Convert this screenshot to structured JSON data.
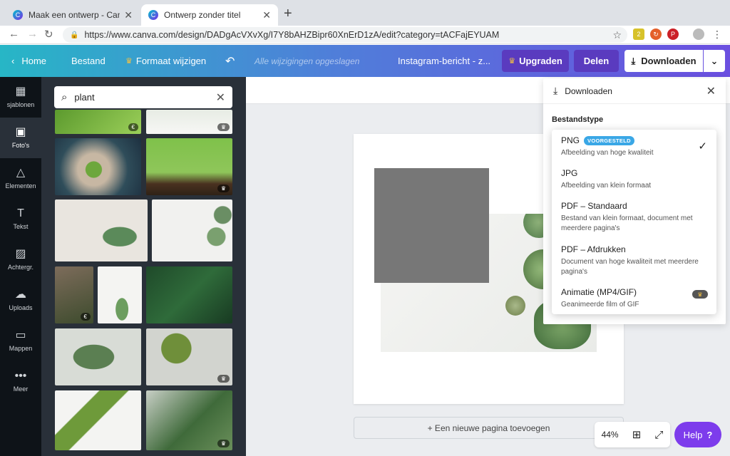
{
  "browser": {
    "tabs": [
      {
        "title": "Maak een ontwerp - Canva",
        "favicon": "C"
      },
      {
        "title": "Ontwerp zonder titel",
        "favicon": "C"
      }
    ],
    "url": "https://www.canva.com/design/DADgAcVXvXg/I7Y8bAHZBipr60XnErD1zA/edit?category=tACFajEYUAM",
    "extension_badge": "2"
  },
  "topbar": {
    "home": "Home",
    "file": "Bestand",
    "resize": "Formaat wijzigen",
    "saved_status": "Alle wijzigingen opgeslagen",
    "design_title": "Instagram-bericht - z...",
    "upgrade": "Upgraden",
    "share": "Delen",
    "download": "Downloaden"
  },
  "rail": [
    {
      "label": "sjablonen",
      "icon": "layout-icon"
    },
    {
      "label": "Foto's",
      "icon": "photo-icon"
    },
    {
      "label": "Elementen",
      "icon": "shapes-icon"
    },
    {
      "label": "Tekst",
      "icon": "text-icon"
    },
    {
      "label": "Achtergr.",
      "icon": "background-icon"
    },
    {
      "label": "Uploads",
      "icon": "upload-icon"
    },
    {
      "label": "Mappen",
      "icon": "folder-icon"
    },
    {
      "label": "Meer",
      "icon": "more-icon"
    }
  ],
  "search": {
    "value": "plant"
  },
  "badges": {
    "paid": "€",
    "premium": "♛"
  },
  "canvas": {
    "add_page": "+ Een nieuwe pagina toevoegen",
    "zoom": "44%",
    "help": "Help",
    "help_mark": "?"
  },
  "download_panel": {
    "title": "Downloaden",
    "filetype_label": "Bestandstype",
    "options": [
      {
        "name": "PNG",
        "badge": "VOORGESTELD",
        "desc": "Afbeelding van hoge kwaliteit"
      },
      {
        "name": "JPG",
        "desc": "Afbeelding van klein formaat"
      },
      {
        "name": "PDF – Standaard",
        "desc": "Bestand van klein formaat, document met meerdere pagina's"
      },
      {
        "name": "PDF – Afdrukken",
        "desc": "Document van hoge kwaliteit met meerdere pagina's"
      },
      {
        "name": "Animatie (MP4/GIF)",
        "desc": "Geanimeerde film of GIF"
      }
    ]
  },
  "colors": {
    "accent": "#7d3cec",
    "topbar_start": "#27b6c6",
    "topbar_end": "#6b4fe0",
    "rail": "#0e1318",
    "panel": "#293039"
  }
}
